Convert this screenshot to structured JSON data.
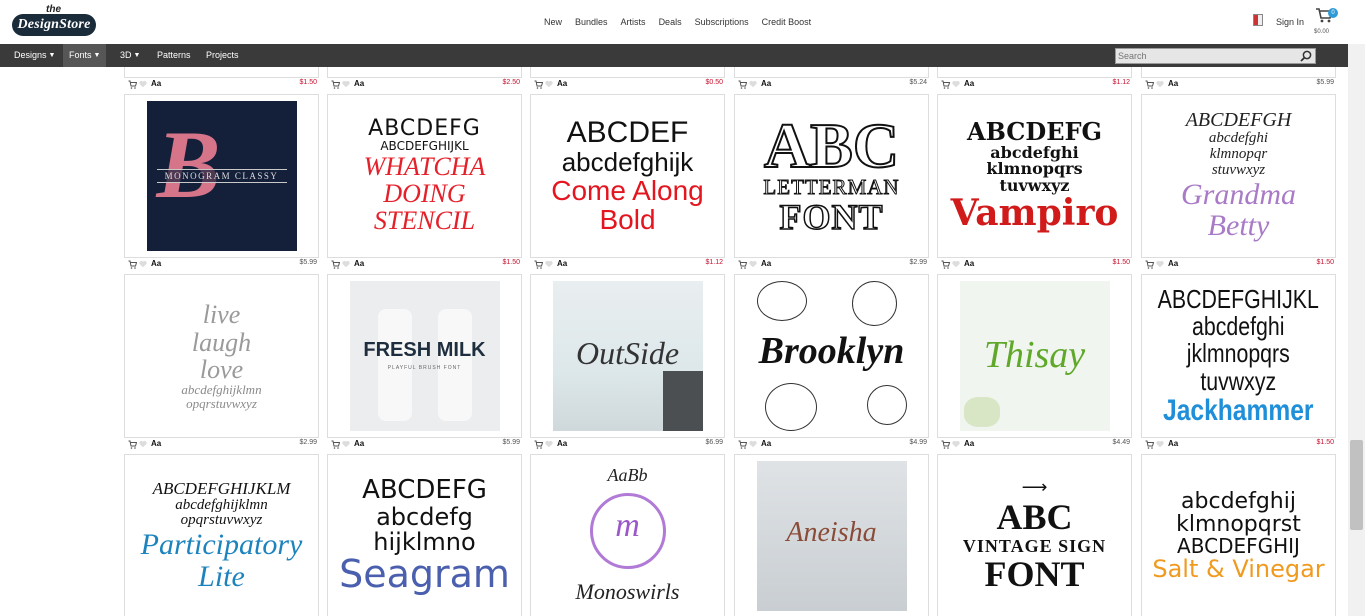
{
  "header": {
    "logo_top": "the",
    "logo_main": "DesignStore",
    "nav": [
      "New",
      "Bundles",
      "Artists",
      "Deals",
      "Subscriptions",
      "Credit Boost"
    ],
    "sign_in": "Sign In",
    "cart_count": "0",
    "cart_total": "$0.00"
  },
  "navbar": {
    "items": [
      {
        "label": "Designs",
        "chevron": true
      },
      {
        "label": "Fonts",
        "chevron": true
      },
      {
        "label": "3D",
        "chevron": true
      },
      {
        "label": "Patterns",
        "chevron": false
      },
      {
        "label": "Projects",
        "chevron": false
      }
    ],
    "search_placeholder": "Search"
  },
  "aa_label": "Aa",
  "prev_row_prices": [
    "$1.50",
    "$2.50",
    "$0.50",
    "$5.24",
    "$1.12",
    "$5.99"
  ],
  "rows": [
    [
      {
        "lines": [
          "MONOGRAM CLASSY"
        ],
        "price": "$5.99"
      },
      {
        "lines": [
          "ABCDEFG",
          "ABCDEFGHIJKL",
          "WHATCHA",
          "DOING",
          "STENCIL"
        ],
        "price": "$1.50"
      },
      {
        "lines": [
          "ABCDEF",
          "abcdefghijk",
          "Come Along",
          "Bold"
        ],
        "price": "$1.12"
      },
      {
        "lines": [
          "ABC",
          "LETTERMAN",
          "FONT"
        ],
        "price": "$2.99"
      },
      {
        "lines": [
          "ABCDEFG",
          "abcdefghi",
          "klmnopqrs",
          "tuvwxyz",
          "Vampiro"
        ],
        "price": "$1.50"
      },
      {
        "lines": [
          "ABCDEFGH",
          "abcdefghi",
          "klmnopqr",
          "stuvwxyz",
          "Grandma",
          "Betty"
        ],
        "price": "$1.50"
      }
    ],
    [
      {
        "lines": [
          "live",
          "laugh",
          "love",
          "abcdefghijklmn",
          "opqrstuvwxyz"
        ],
        "price": "$2.99"
      },
      {
        "lines": [
          "FRESH MILK",
          "PLAYFUL BRUSH FONT"
        ],
        "price": "$5.99"
      },
      {
        "lines": [
          "OutSide"
        ],
        "price": "$6.99"
      },
      {
        "lines": [
          "Brooklyn"
        ],
        "price": "$4.99"
      },
      {
        "lines": [
          "Thisay"
        ],
        "price": "$4.49"
      },
      {
        "lines": [
          "ABCDEFGHIJKL",
          "abcdefghi",
          "jklmnopqrs",
          "tuvwxyz",
          "Jackhammer"
        ],
        "price": "$1.50"
      }
    ],
    [
      {
        "lines": [
          "ABCDEFGHIJKLM",
          "abcdefghijklmn",
          "opqrstuvwxyz",
          "Participatory",
          "Lite"
        ],
        "price": ""
      },
      {
        "lines": [
          "ABCDEFG",
          "abcdefg",
          "hijklmno",
          "Seagram"
        ],
        "price": ""
      },
      {
        "lines": [
          "AaBb",
          "m",
          "Monoswirls"
        ],
        "price": ""
      },
      {
        "lines": [
          "Aneisha"
        ],
        "price": ""
      },
      {
        "lines": [
          "ABC",
          "VINTAGE SIGN",
          "FONT"
        ],
        "price": ""
      },
      {
        "lines": [
          "abcdefghij",
          "klmnopqrst",
          "ABCDEFGHIJ",
          "Salt & Vinegar"
        ],
        "price": ""
      }
    ]
  ],
  "colors": {
    "navbar_bg": "#3a3a3a",
    "price_red": "#c8102e",
    "accent_blue": "#2e9bd6"
  }
}
